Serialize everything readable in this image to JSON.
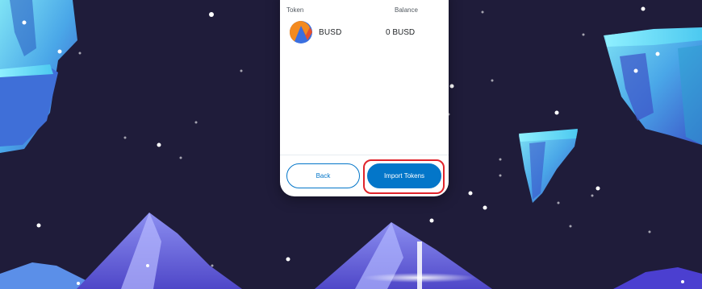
{
  "colors": {
    "accent": "#0376c9",
    "highlight": "#e0242b",
    "background": "#1f1c3a"
  },
  "token_list": {
    "header_token": "Token",
    "header_balance": "Balance",
    "items": [
      {
        "symbol": "BUSD",
        "balance": "0 BUSD",
        "icon": "busd-token-icon"
      }
    ]
  },
  "actions": {
    "back_label": "Back",
    "import_label": "Import Tokens"
  }
}
